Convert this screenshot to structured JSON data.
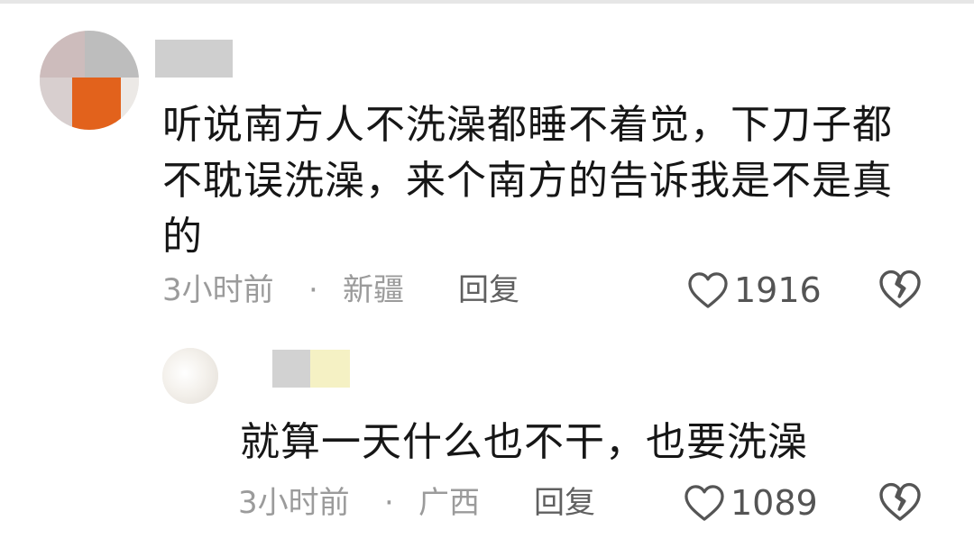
{
  "main_comment": {
    "username": "",
    "text": "听说南方人不洗澡都睡不着觉，下刀子都不耽误洗澡，来个南方的告诉我是不是真的",
    "time": "3小时前",
    "separator": "·",
    "location": "新疆",
    "reply_label": "回复",
    "like_count": "1916",
    "icons": {
      "like": "heart-outline-icon",
      "dislike": "broken-heart-icon"
    }
  },
  "reply_comment": {
    "username": "",
    "text": "就算一天什么也不干，也要洗澡",
    "time": "3小时前",
    "separator": "·",
    "location": "广西",
    "reply_label": "回复",
    "like_count": "1089",
    "icons": {
      "like": "heart-outline-icon",
      "dislike": "broken-heart-icon"
    }
  },
  "colors": {
    "text": "#161616",
    "meta": "#9b9b9b",
    "reply": "#606060",
    "icon": "#555555",
    "blur_gray": "#cfcfcf",
    "blur_yellow": "#f5f1c4"
  }
}
